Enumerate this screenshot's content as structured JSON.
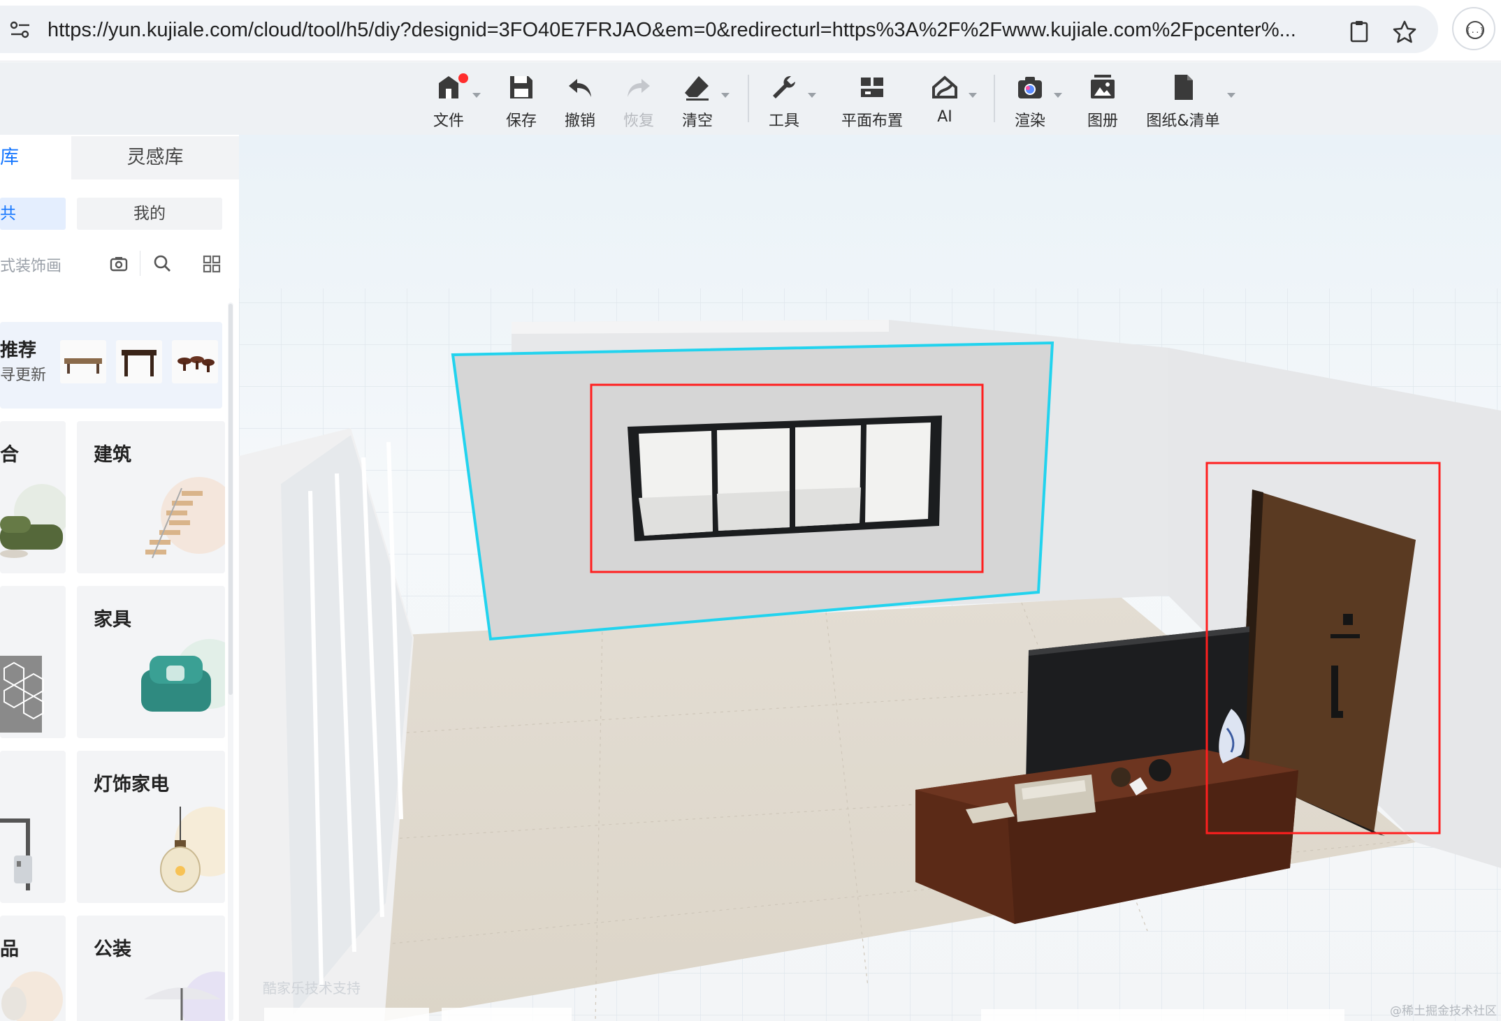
{
  "browser": {
    "url": "https://yun.kujiale.com/cloud/tool/h5/diy?designid=3FO40E7FRJAO&em=0&redirecturl=https%3A%2F%2Fwww.kujiale.com%2Fpcenter%..."
  },
  "toolbar": {
    "file": "文件",
    "save": "保存",
    "undo": "撤销",
    "redo": "恢复",
    "clear": "清空",
    "tools": "工具",
    "floorplan": "平面布置",
    "ai": "AI",
    "render": "渲染",
    "album": "图册",
    "drawings": "图纸&清单"
  },
  "panel": {
    "tabs": [
      "库",
      "灵感库"
    ],
    "segments": [
      "共",
      "我的"
    ],
    "search_placeholder": "式装饰画",
    "recommend": {
      "title": "推荐",
      "subtitle": "寻更新"
    },
    "categories": [
      {
        "title": "合"
      },
      {
        "title": "建筑"
      },
      {
        "title": ""
      },
      {
        "title": "家具"
      },
      {
        "title": ""
      },
      {
        "title": "灯饰家电"
      },
      {
        "title": "品"
      },
      {
        "title": "公装"
      }
    ]
  },
  "viewport": {
    "watermark": "酷家乐技术支持",
    "credit": "@稀土掘金技术社区",
    "colors": {
      "selected_wall_outline": "#22d3ee",
      "highlight_box": "#ff1f1f",
      "door_wood": "#5a3a22",
      "cabinet_wood": "#5b2a17"
    }
  }
}
